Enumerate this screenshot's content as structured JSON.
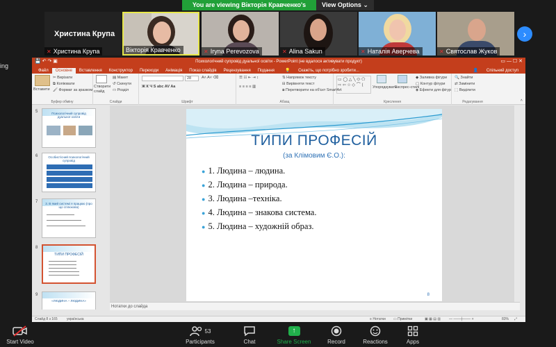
{
  "banner": {
    "viewing_text": "You are viewing Вікторія Кравченко's screen",
    "view_options": "View Options"
  },
  "participants_strip": {
    "tiles": [
      {
        "name": "Христина Крупа",
        "big_name": "Христина Крупа"
      },
      {
        "name": "Вікторія Кравченко"
      },
      {
        "name": "Iryna Perevozova"
      },
      {
        "name": "Alina Sakun"
      },
      {
        "name": "Наталія Аверчева"
      },
      {
        "name": "Святослав Жуков"
      }
    ],
    "left_partial": "ing"
  },
  "ppt": {
    "window_title": "Психологічний супровід дуальної освіти - PowerPoint (не вдалося активувати продукт)",
    "tabs": [
      "Файл",
      "Основне",
      "Вставлення",
      "Конструктор",
      "Переходи",
      "Анімація",
      "Показ слайдів",
      "Рецензування",
      "Подання"
    ],
    "tell_me": "Скажіть, що потрібно зробити...",
    "share": "Спільний доступ",
    "ribbon": {
      "paste": "Вставити",
      "clipboard": [
        "Вирізати",
        "Копіювати",
        "Формат за зразком"
      ],
      "clipboard_label": "Буфер обміну",
      "new_slide": "Створити слайд",
      "slides_items": [
        "Макет",
        "Скинути",
        "Розділ"
      ],
      "slides_label": "Слайди",
      "font_size": "28",
      "font_label": "Шрифт",
      "paragraph_items": [
        "Напрямок тексту",
        "Вирівняти текст",
        "Перетворити на об'єкт SmartArt"
      ],
      "paragraph_label": "Абзац",
      "arrange": "Упорядкувати",
      "quick_styles": "Експрес-стилі",
      "drawing_items": [
        "Заливка фігури",
        "Контур фігури",
        "Ефекти для фігур"
      ],
      "drawing_label": "Креслення",
      "edit_items": [
        "Знайти",
        "Замінити",
        "Виділити"
      ],
      "edit_label": "Редагування"
    },
    "thumbnails": [
      {
        "num": "5",
        "title": "Психологічний супровід дуальної освіти"
      },
      {
        "num": "6",
        "title": "Особистісний психологічний супровід"
      },
      {
        "num": "7",
        "title": "3. В який системі я працюю (про що сплюкова)"
      },
      {
        "num": "8",
        "title": "ТИПИ ПРОФЕСІЙ"
      },
      {
        "num": "9",
        "title": "«ЛЮДИНА – ЛЮДИНА»"
      }
    ],
    "slide": {
      "title": "ТИПИ ПРОФЕСІЙ",
      "subtitle": "(за Клімовим Є.О.):",
      "items": [
        "1. Людина – людина.",
        "2. Людина – природа.",
        "3. Людина –техніка.",
        "4. Людина – знакова система.",
        "5. Людина – художній образ."
      ],
      "page_number": "8"
    },
    "notes_placeholder": "Нотатки до слайда",
    "status": {
      "slide_counter": "Слайд 8 з 165",
      "language": "українська",
      "notes": "Нотатки",
      "comments": "Примітки",
      "zoom": "83%"
    },
    "accent": "#c43e1c"
  },
  "zoom_toolbar": {
    "start_video": "Start Video",
    "participants": "Participants",
    "participants_count": "53",
    "chat": "Chat",
    "share_screen": "Share Screen",
    "record": "Record",
    "reactions": "Reactions",
    "apps": "Apps"
  }
}
